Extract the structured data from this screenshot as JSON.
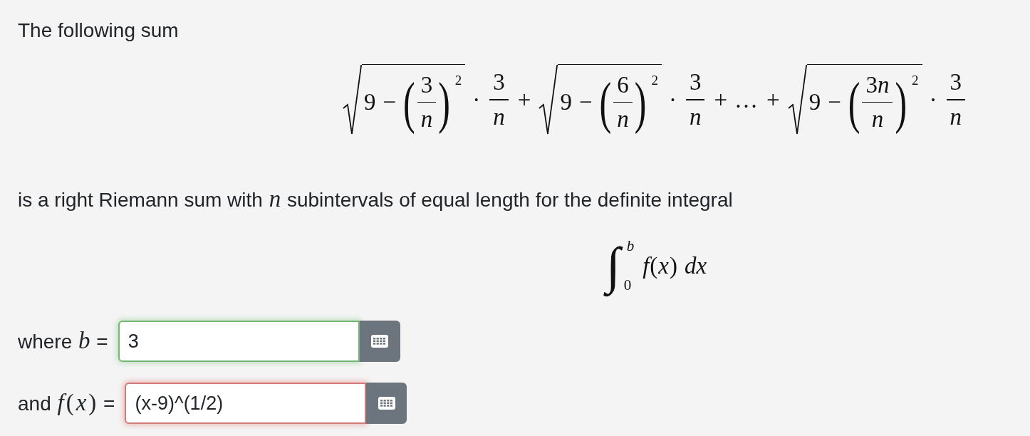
{
  "intro": {
    "text": "The following sum"
  },
  "sum_formula": [
    {
      "kind": "sqrt",
      "children": [
        {
          "kind": "num",
          "text": "9"
        },
        {
          "kind": "op",
          "text": "−"
        },
        {
          "kind": "paren",
          "open": "(",
          "close": ")",
          "sup": "2",
          "children": [
            {
              "kind": "frac",
              "num": [
                {
                  "kind": "num",
                  "text": "3"
                }
              ],
              "den": [
                {
                  "kind": "var",
                  "text": "n"
                }
              ]
            }
          ]
        }
      ]
    },
    {
      "kind": "op",
      "text": "·"
    },
    {
      "kind": "frac",
      "num": [
        {
          "kind": "num",
          "text": "3"
        }
      ],
      "den": [
        {
          "kind": "var",
          "text": "n"
        }
      ]
    },
    {
      "kind": "op",
      "text": "+"
    },
    {
      "kind": "sqrt",
      "children": [
        {
          "kind": "num",
          "text": "9"
        },
        {
          "kind": "op",
          "text": "−"
        },
        {
          "kind": "paren",
          "open": "(",
          "close": ")",
          "sup": "2",
          "children": [
            {
              "kind": "frac",
              "num": [
                {
                  "kind": "num",
                  "text": "6"
                }
              ],
              "den": [
                {
                  "kind": "var",
                  "text": "n"
                }
              ]
            }
          ]
        }
      ]
    },
    {
      "kind": "op",
      "text": "·"
    },
    {
      "kind": "frac",
      "num": [
        {
          "kind": "num",
          "text": "3"
        }
      ],
      "den": [
        {
          "kind": "var",
          "text": "n"
        }
      ]
    },
    {
      "kind": "op",
      "text": "+"
    },
    {
      "kind": "ellipsis",
      "text": "…"
    },
    {
      "kind": "op",
      "text": "+"
    },
    {
      "kind": "sqrt",
      "children": [
        {
          "kind": "num",
          "text": "9"
        },
        {
          "kind": "op",
          "text": "−"
        },
        {
          "kind": "paren",
          "open": "(",
          "close": ")",
          "sup": "2",
          "children": [
            {
              "kind": "frac",
              "num": [
                {
                  "kind": "num",
                  "text": "3"
                },
                {
                  "kind": "var",
                  "text": "n"
                }
              ],
              "den": [
                {
                  "kind": "var",
                  "text": "n"
                }
              ]
            }
          ]
        }
      ]
    },
    {
      "kind": "op",
      "text": "·"
    },
    {
      "kind": "frac",
      "num": [
        {
          "kind": "num",
          "text": "3"
        }
      ],
      "den": [
        {
          "kind": "var",
          "text": "n"
        }
      ]
    }
  ],
  "sentence": {
    "parts": [
      {
        "kind": "text",
        "text": "is a right Riemann sum with "
      },
      {
        "kind": "var",
        "text": "n"
      },
      {
        "kind": "text",
        "text": " subintervals of equal length for the definite integral"
      }
    ]
  },
  "integral": {
    "sign": "∫",
    "upper": "b",
    "lower": "0",
    "integrand": [
      {
        "kind": "var",
        "text": "f"
      },
      {
        "kind": "sym",
        "text": "("
      },
      {
        "kind": "var",
        "text": "x"
      },
      {
        "kind": "sym",
        "text": ")"
      }
    ],
    "differential": "dx"
  },
  "answers": [
    {
      "label": [
        {
          "kind": "text",
          "text": "where "
        },
        {
          "kind": "var",
          "text": "b"
        },
        {
          "kind": "text",
          "text": " ="
        }
      ],
      "value": "3",
      "correct": true
    },
    {
      "label": [
        {
          "kind": "text",
          "text": "and "
        },
        {
          "kind": "var",
          "text": "f"
        },
        {
          "kind": "sym",
          "text": "("
        },
        {
          "kind": "var",
          "text": "x"
        },
        {
          "kind": "sym",
          "text": ")"
        },
        {
          "kind": "text",
          "text": " ="
        }
      ],
      "value": "(x-9)^(1/2)",
      "correct": false
    }
  ]
}
